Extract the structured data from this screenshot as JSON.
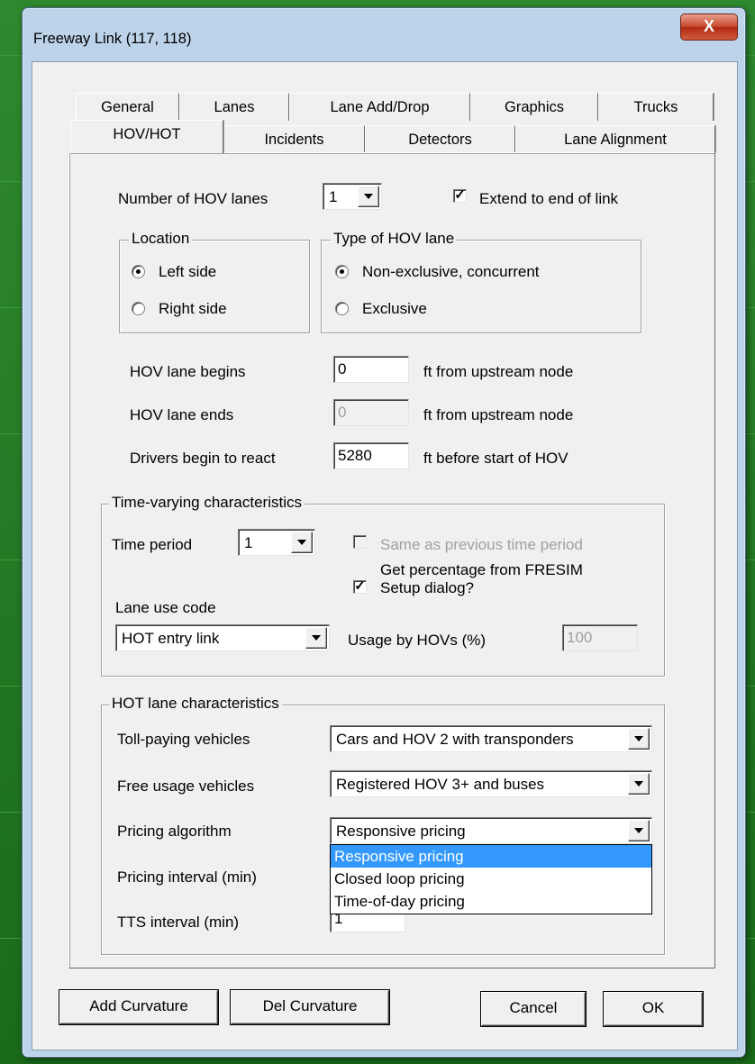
{
  "window": {
    "title": "Freeway Link (117, 118)",
    "close_glyph": "X"
  },
  "tabs_row1": [
    "General",
    "Lanes",
    "Lane Add/Drop",
    "Graphics",
    "Trucks"
  ],
  "tabs_row2": [
    "HOV/HOT",
    "Incidents",
    "Detectors",
    "Lane Alignment"
  ],
  "hov": {
    "num_lanes_label": "Number of HOV lanes",
    "num_lanes_value": "1",
    "extend_label": "Extend to end of link",
    "extend_checked": true,
    "location_legend": "Location",
    "left_side": "Left side",
    "right_side": "Right side",
    "type_legend": "Type of HOV lane",
    "non_exclusive": "Non-exclusive, concurrent",
    "exclusive": "Exclusive",
    "begins_label": "HOV lane begins",
    "begins_value": "0",
    "begins_unit": "ft from upstream node",
    "ends_label": "HOV lane ends",
    "ends_value": "0",
    "ends_unit": "ft from upstream node",
    "react_label": "Drivers begin to react",
    "react_value": "5280",
    "react_unit": "ft before start of HOV"
  },
  "time_varying": {
    "legend": "Time-varying characteristics",
    "period_label": "Time period",
    "period_value": "1",
    "same_prev_label": "Same as previous time period",
    "get_pct_label_1": "Get percentage from FRESIM",
    "get_pct_label_2": "Setup dialog?",
    "lane_use_label": "Lane use code",
    "lane_use_value": "HOT entry link",
    "usage_label": "Usage by HOVs (%)",
    "usage_value": "100"
  },
  "hot": {
    "legend": "HOT lane characteristics",
    "toll_label": "Toll-paying vehicles",
    "toll_value": "Cars and HOV 2 with transponders",
    "free_label": "Free usage vehicles",
    "free_value": "Registered HOV 3+ and buses",
    "pricing_label": "Pricing algorithm",
    "pricing_value": "Responsive pricing",
    "pricing_options": [
      "Responsive pricing",
      "Closed loop pricing",
      "Time-of-day pricing"
    ],
    "interval_label": "Pricing interval (min)",
    "tts_label": "TTS interval (min)",
    "tts_value": "1"
  },
  "buttons": {
    "add_curvature": "Add Curvature",
    "del_curvature": "Del Curvature",
    "cancel": "Cancel",
    "ok": "OK"
  }
}
